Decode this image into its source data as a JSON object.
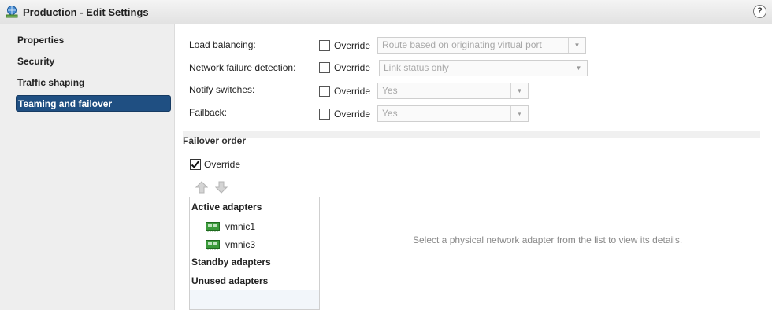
{
  "window": {
    "title": "Production - Edit Settings",
    "help_label": "?"
  },
  "sidebar": {
    "items": [
      {
        "label": "Properties",
        "selected": false
      },
      {
        "label": "Security",
        "selected": false
      },
      {
        "label": "Traffic shaping",
        "selected": false
      },
      {
        "label": "Teaming and failover",
        "selected": true
      }
    ]
  },
  "settings": {
    "rows": [
      {
        "label": "Load balancing:",
        "override_label": "Override",
        "override_checked": false,
        "value": "Route based on originating virtual port"
      },
      {
        "label": "Network failure detection:",
        "override_label": "Override",
        "override_checked": false,
        "value": "Link status only"
      },
      {
        "label": "Notify switches:",
        "override_label": "Override",
        "override_checked": false,
        "value": "Yes"
      },
      {
        "label": "Failback:",
        "override_label": "Override",
        "override_checked": false,
        "value": "Yes"
      }
    ]
  },
  "failover": {
    "title": "Failover order",
    "override_label": "Override",
    "override_checked": true,
    "groups": {
      "active": "Active adapters",
      "standby": "Standby adapters",
      "unused": "Unused adapters"
    },
    "active_adapters": [
      "vmnic1",
      "vmnic3"
    ],
    "details_message": "Select a physical network adapter from the list to view its details."
  },
  "icons": {
    "title": "network-globe-icon",
    "help": "help-icon",
    "move_up": "arrow-up-icon",
    "move_down": "arrow-down-icon",
    "adapter": "nic-icon",
    "dropdown": "chevron-down-icon"
  },
  "colors": {
    "selection": "#1f4f82",
    "nic_green": "#3a9a3a",
    "disabled_text": "#a8a8a8"
  }
}
